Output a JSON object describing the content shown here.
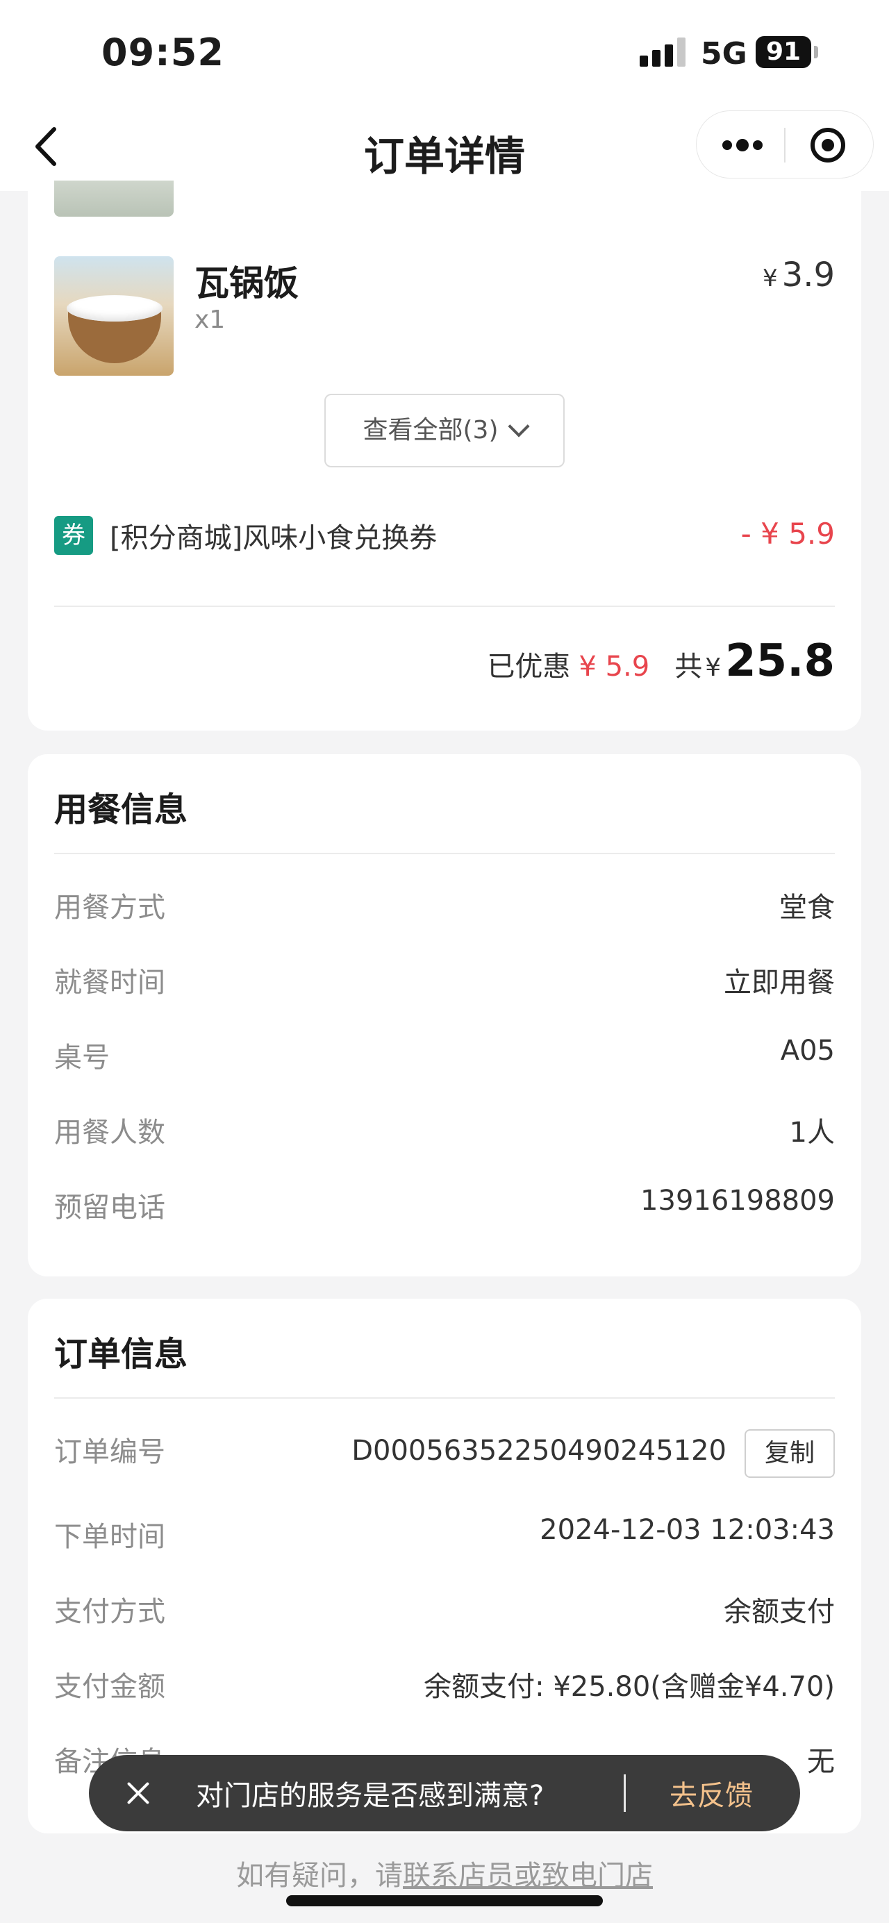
{
  "status_bar": {
    "time": "09:52",
    "network": "5G",
    "battery": "91"
  },
  "nav": {
    "title": "订单详情"
  },
  "order_items": {
    "items": [
      {
        "name": "瓦锅饭",
        "qty": "x1",
        "currency": "¥",
        "price": "3.9"
      }
    ],
    "view_all_label": "查看全部(3)",
    "coupon": {
      "badge": "券",
      "name": "[积分商城]风味小食兑换券",
      "amount": "- ¥ 5.9"
    },
    "discount_label": "已优惠",
    "discount_value": "¥ 5.9",
    "total_label": "共",
    "total_currency": "¥",
    "total_value": "25.8"
  },
  "dining_info": {
    "title": "用餐信息",
    "rows": [
      {
        "label": "用餐方式",
        "value": "堂食"
      },
      {
        "label": "就餐时间",
        "value": "立即用餐"
      },
      {
        "label": "桌号",
        "value": "A05"
      },
      {
        "label": "用餐人数",
        "value": "1人"
      },
      {
        "label": "预留电话",
        "value": "13916198809"
      }
    ]
  },
  "order_info": {
    "title": "订单信息",
    "copy_label": "复制",
    "rows": [
      {
        "label": "订单编号",
        "value": "D000563522504902451​20"
      },
      {
        "label": "下单时间",
        "value": "2024-12-03 12:03:43"
      },
      {
        "label": "支付方式",
        "value": "余额支付"
      },
      {
        "label": "支付金额",
        "value": "余额支付: ¥25.80(含赠金¥4.70)"
      },
      {
        "label": "备注信息",
        "value": "无"
      }
    ]
  },
  "feedback_toast": {
    "text": "对门店的服务是否感到满意?",
    "action": "去反馈"
  },
  "footer": {
    "prefix": "如有疑问，请",
    "link": "联系店员或致电门店"
  }
}
